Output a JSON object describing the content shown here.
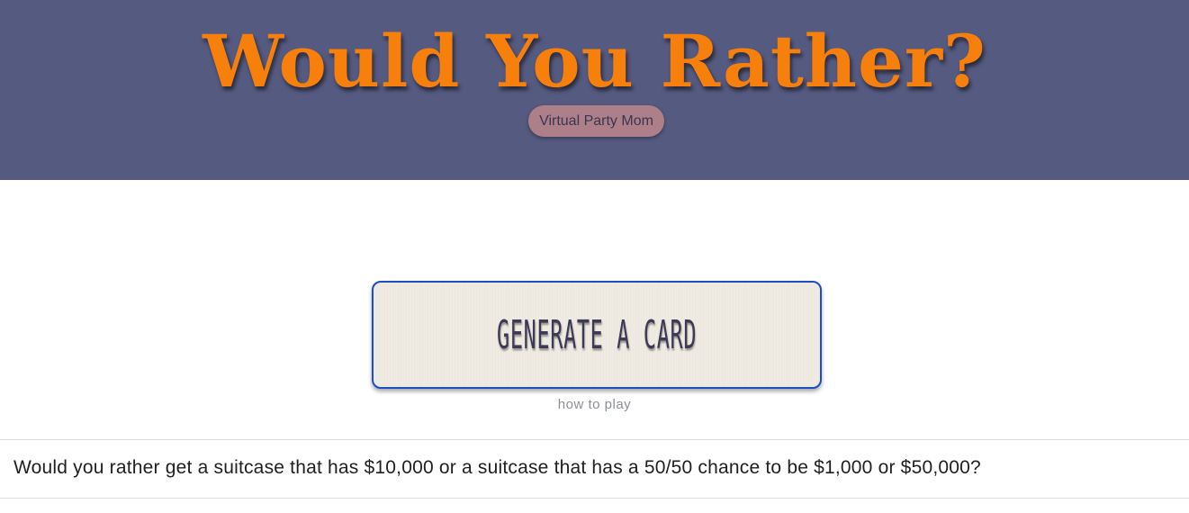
{
  "header": {
    "title": "Would You Rather?",
    "badge_label": "Virtual Party Mom"
  },
  "main": {
    "generate_button_label": "Generate a Card",
    "how_to_play_label": "how to play"
  },
  "question": {
    "text": "Would you rather get a suitcase that has $10,000 or a suitcase that has a 50/50 chance to be $1,000 or $50,000?"
  },
  "colors": {
    "header_background": "#555a80",
    "title": "#f77f0c",
    "badge_background": "#ad8089",
    "button_background": "#efebe3",
    "button_border": "#1d4fc4"
  }
}
